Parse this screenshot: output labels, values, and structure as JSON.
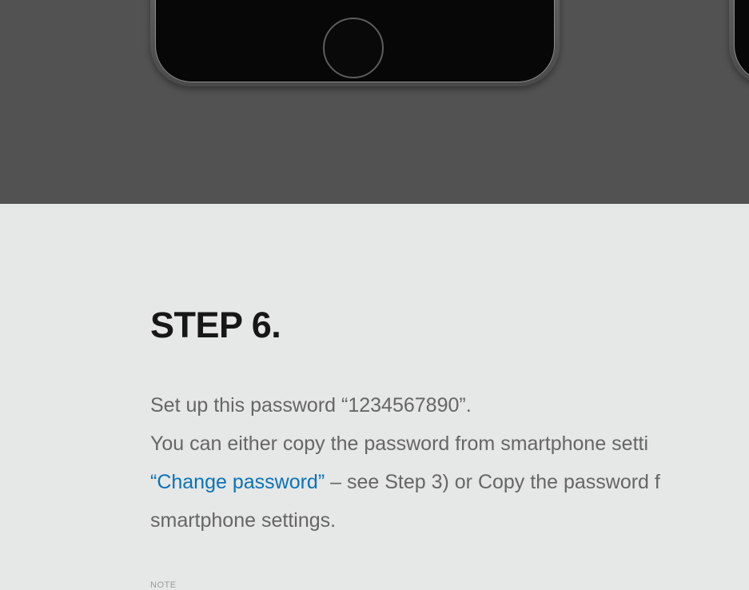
{
  "hero": {
    "background": "#525252",
    "devices": [
      "phone-left",
      "phone-right"
    ],
    "icon": "home-button-icon"
  },
  "step": {
    "title": "STEP 6.",
    "line1": "Set up this password “1234567890”.",
    "line2": "You can either copy the password from smartphone setti",
    "line3_link": "“Change password”",
    "line3_rest": " – see Step 3) or Copy the password f",
    "line4": "smartphone settings.",
    "note_label": "NOTE"
  },
  "colors": {
    "link": "#0a73b8",
    "text": "#666666",
    "title": "#171717",
    "background": "#e6e7e7"
  }
}
